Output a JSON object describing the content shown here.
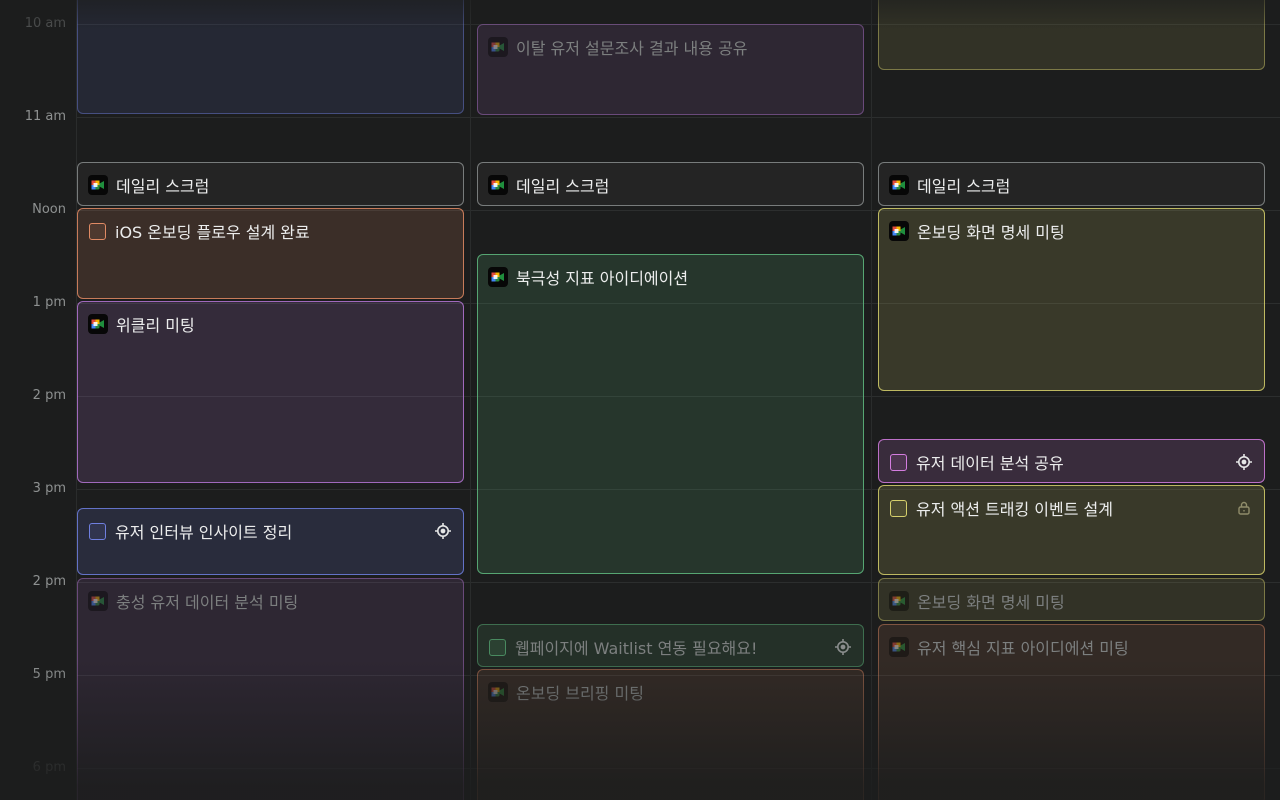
{
  "time_labels": [
    "10 am",
    "11 am",
    "Noon",
    "1 pm",
    "2 pm",
    "3 pm",
    "2 pm",
    "5 pm",
    "6 pm"
  ],
  "colors": {
    "background": "#1c1d1d",
    "blue": "#6f7fe0",
    "purple": "#b476d3",
    "orange": "#e08a64",
    "green": "#5fba7f",
    "yellow": "#d6d06c",
    "gray": "#7b7e7e",
    "magenta": "#d47de0"
  },
  "columns": [
    {
      "events": [
        {
          "title": "",
          "kind": "block",
          "tint": "blue",
          "dim": true
        },
        {
          "title": "데일리 스크럼",
          "kind": "meet",
          "tint": "gray",
          "dim": false
        },
        {
          "title": "iOS 온보딩 플로우 설계 완료",
          "kind": "task",
          "tint": "orange",
          "dim": false
        },
        {
          "title": "위클리 미팅",
          "kind": "meet",
          "tint": "purple",
          "dim": false
        },
        {
          "title": "유저 인터뷰 인사이트 정리",
          "kind": "task",
          "tint": "blue",
          "dim": false,
          "trail": "crosshair-icon"
        },
        {
          "title": "충성 유저 데이터 분석 미팅",
          "kind": "meet",
          "tint": "purple",
          "dim": true
        }
      ]
    },
    {
      "events": [
        {
          "title": "이탈 유저 설문조사 결과 내용 공유",
          "kind": "meet",
          "tint": "purple",
          "dim": true
        },
        {
          "title": "데일리 스크럼",
          "kind": "meet",
          "tint": "gray",
          "dim": false
        },
        {
          "title": "북극성 지표 아이디에이션",
          "kind": "meet",
          "tint": "green",
          "dim": false
        },
        {
          "title": "웹페이지에 Waitlist 연동 필요해요!",
          "kind": "task",
          "tint": "green",
          "dim": true,
          "trail": "crosshair-icon"
        },
        {
          "title": "온보딩 브리핑 미팅",
          "kind": "meet",
          "tint": "orange",
          "dim": true
        }
      ]
    },
    {
      "events": [
        {
          "title": "",
          "kind": "block",
          "tint": "yellow",
          "dim": true
        },
        {
          "title": "데일리 스크럼",
          "kind": "meet",
          "tint": "gray",
          "dim": false
        },
        {
          "title": "온보딩 화면 명세 미팅",
          "kind": "meet",
          "tint": "yellow",
          "dim": false
        },
        {
          "title": "유저 데이터 분석 공유",
          "kind": "task",
          "tint": "magenta",
          "dim": false,
          "trail": "crosshair-icon"
        },
        {
          "title": "유저 액션 트래킹 이벤트 설계",
          "kind": "task",
          "tint": "yellow",
          "dim": false,
          "trail": "lock-icon"
        },
        {
          "title": "온보딩 화면 명세 미팅",
          "kind": "meet",
          "tint": "yellow",
          "dim": true
        },
        {
          "title": "유저 핵심 지표 아이디에션 미팅",
          "kind": "meet",
          "tint": "orange",
          "dim": true
        }
      ]
    }
  ]
}
